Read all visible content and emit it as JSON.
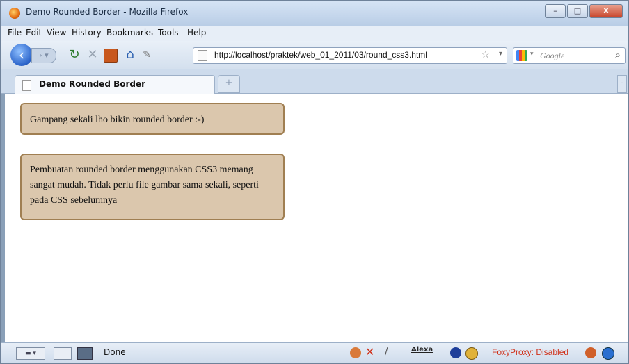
{
  "window": {
    "title": "Demo Rounded Border - Mozilla Firefox",
    "min": "–",
    "max": "□",
    "close": "X"
  },
  "menu": [
    "File",
    "Edit",
    "View",
    "History",
    "Bookmarks",
    "Tools",
    "Help"
  ],
  "nav": {
    "url": "http://localhost/praktek/web_01_2011/03/round_css3.html",
    "search_placeholder": "Google"
  },
  "tabs": [
    {
      "label": "Demo Rounded Border"
    }
  ],
  "newtab_label": "+",
  "content": {
    "box1": "Gampang sekali lho bikin rounded border :-)",
    "box2": "Pembuatan rounded border menggunakan CSS3 memang sangat mudah. Tidak perlu file gambar sama sekali, seperti pada CSS sebelumnya"
  },
  "status": {
    "text": "Done",
    "alexa": "Alexa",
    "foxyproxy": "FoxyProxy: Disabled"
  },
  "colors": {
    "box_bg": "#dbc7ad",
    "box_border": "#a07f52",
    "foxy": "#d0311a"
  }
}
